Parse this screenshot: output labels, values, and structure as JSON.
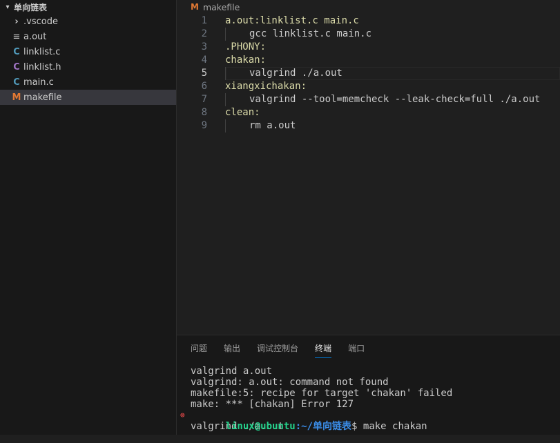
{
  "explorer": {
    "folder_name": "单向链表",
    "items": [
      {
        "icon": "›",
        "name": ".vscode",
        "color": "#cccccc"
      },
      {
        "icon": "≡",
        "name": "a.out",
        "color": "#cccccc"
      },
      {
        "icon": "C",
        "name": "linklist.c",
        "color": "#519aba"
      },
      {
        "icon": "C",
        "name": "linklist.h",
        "color": "#a074c4"
      },
      {
        "icon": "C",
        "name": "main.c",
        "color": "#519aba"
      },
      {
        "icon": "M",
        "name": "makefile",
        "color": "#e37933"
      }
    ]
  },
  "editor": {
    "breadcrumb_icon": "M",
    "breadcrumb_file": "makefile",
    "lines": [
      {
        "num": "1",
        "text": "a.out:linklist.c main.c"
      },
      {
        "num": "2",
        "text": "gcc linklist.c main.c"
      },
      {
        "num": "3",
        "text": ".PHONY:"
      },
      {
        "num": "4",
        "text": "chakan:"
      },
      {
        "num": "5",
        "text": "valgrind ./a.out"
      },
      {
        "num": "6",
        "text": "xiangxichakan:"
      },
      {
        "num": "7",
        "text": "valgrind --tool=memcheck --leak-check=full ./a.out"
      },
      {
        "num": "8",
        "text": "clean:"
      },
      {
        "num": "9",
        "text": "rm a.out"
      }
    ]
  },
  "panel": {
    "tabs": [
      "问题",
      "输出",
      "调试控制台",
      "终端",
      "端口"
    ],
    "active_tab": "终端",
    "terminal": {
      "lines": [
        "valgrind a.out",
        "valgrind: a.out: command not found",
        "makefile:5: recipe for target 'chakan' failed",
        "make: *** [chakan] Error 127"
      ],
      "prompt_user": "linux@ubuntu",
      "prompt_path": ":~/单向链表",
      "prompt_cmd": "$ make chakan",
      "after_prompt": "valgrind ./a.out"
    }
  },
  "colors": {
    "accent": "#0078d4",
    "makefile_target": "#dcdcaa",
    "prompt_user": "#23d18b",
    "prompt_path": "#3b8eea",
    "error": "#f14c4c"
  }
}
